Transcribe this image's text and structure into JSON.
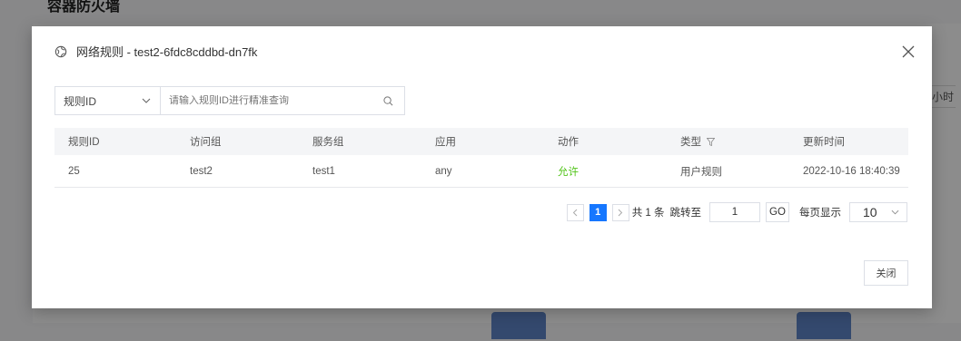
{
  "background": {
    "title": "容器防火墙",
    "side_label": "小时"
  },
  "modal": {
    "title": "网络规则 - test2-6fdc8cddbd-dn7fk",
    "filter": {
      "select_value": "规则ID",
      "input_placeholder": "请输入规则ID进行精准查询"
    },
    "table": {
      "headers": [
        "规则ID",
        "访问组",
        "服务组",
        "应用",
        "动作",
        "类型",
        "更新时间"
      ],
      "rows": [
        {
          "id": "25",
          "access_group": "test2",
          "service_group": "test1",
          "app": "any",
          "action": "允许",
          "type": "用户规则",
          "updated": "2022-10-16 18:40:39"
        }
      ]
    },
    "pagination": {
      "current_page": "1",
      "total_text": "共 1 条",
      "jump_label": "跳转至",
      "jump_value": "1",
      "go_label": "GO",
      "page_size_label": "每页显示",
      "page_size": "10"
    },
    "close_label": "关闭"
  },
  "colors": {
    "accent": "#1677ff",
    "allow": "#52c41a"
  }
}
